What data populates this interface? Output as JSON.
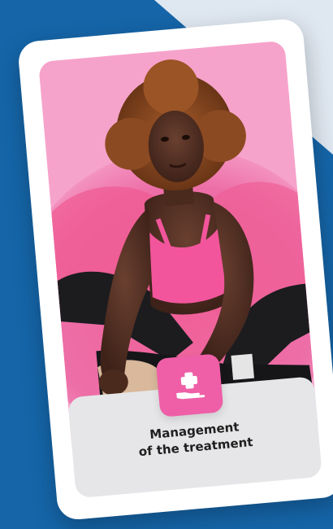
{
  "card": {
    "caption_line1": "Management",
    "caption_line2": "of the treatment",
    "icon": "hand-with-medical-cross-icon",
    "photo": "woman-stretching-on-pink-background"
  },
  "colors": {
    "background": "#1565a8",
    "card": "#ffffff",
    "accent": "#ee5fa7",
    "photo_background": "#f6a3cb",
    "caption_box": "#e6e6e8"
  }
}
